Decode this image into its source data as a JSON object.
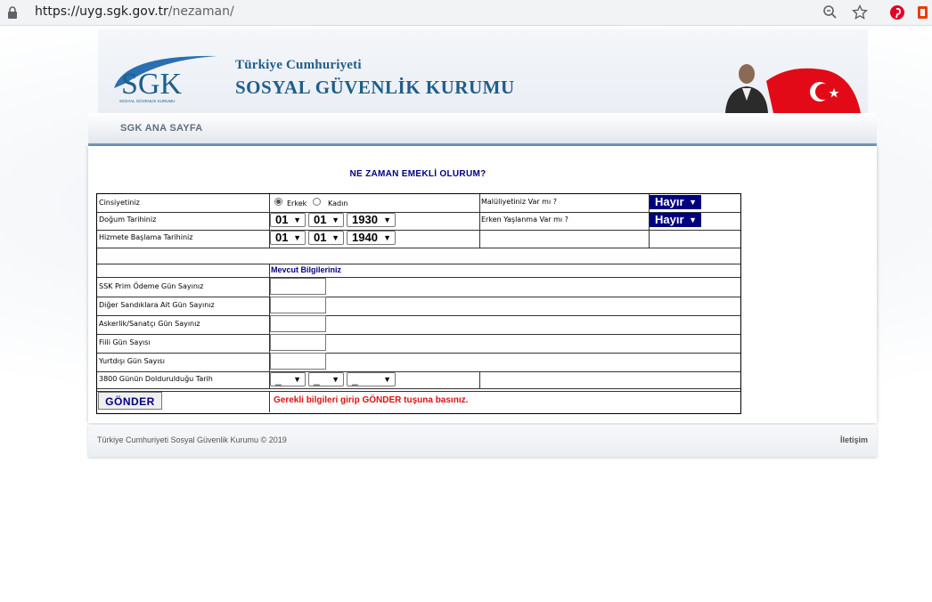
{
  "browser": {
    "url_host": "https://uyg.sgk.gov.tr",
    "url_path": "/nezaman/"
  },
  "header": {
    "logo_text": "SGK",
    "logo_subtext": "SOSYAL GÜVENLİK KURUMU",
    "org_line1": "Türkiye Cumhuriyeti",
    "org_line2": "SOSYAL GÜVENLİK KURUMU"
  },
  "nav": {
    "home_label": "SGK ANA SAYFA"
  },
  "form": {
    "title": "NE ZAMAN EMEKLİ OLURUM?",
    "gender_label": "Cinsiyetiniz",
    "gender_male": "Erkek",
    "gender_female": "Kadın",
    "disability_label": "Malüliyetiniz Var mı ?",
    "disability_value": "Hayır",
    "birth_label": "Doğum Tarihiniz",
    "birth_day": "01",
    "birth_month": "01",
    "birth_year": "1930",
    "early_aging_label": "Erken Yaşlanma Var mı ?",
    "early_aging_value": "Hayır",
    "start_label": "Hizmete Başlama Tarihiniz",
    "start_day": "01",
    "start_month": "01",
    "start_year": "1940",
    "section_title": "Mevcut  Bilgileriniz",
    "rows": [
      {
        "label": "SSK Prim Ödeme Gün Sayınız"
      },
      {
        "label": "Diğer Sandıklara Ait Gün Sayınız"
      },
      {
        "label": "Askerlik/Sanatçı Gün Sayınız"
      },
      {
        "label": "Fiili Gün Sayısı"
      },
      {
        "label": "Yurtdışı Gün Sayısı"
      }
    ],
    "date3800_label": "3800 Günün Doldurulduğu Tarih",
    "date3800_day": "_",
    "date3800_month": "_",
    "date3800_year": "_",
    "submit_label": "GÖNDER",
    "hint": "Gerekli bilgileri girip GÖNDER tuşuna basınız."
  },
  "footer": {
    "copyright": "Türkiye Cumhuriyeti Sosyal Güvenlik Kurumu © 2019",
    "contact": "İletişim"
  },
  "colors": {
    "navy": "#000080",
    "brand_blue": "#1f5e8a",
    "hint_red": "#dd1111",
    "nav_underline": "#7a9cc5"
  }
}
